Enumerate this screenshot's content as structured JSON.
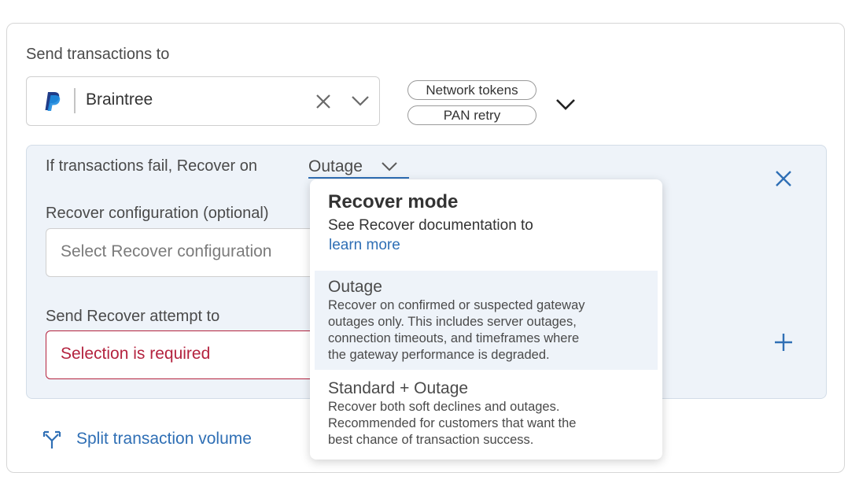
{
  "send_transactions": {
    "label": "Send transactions to",
    "gateway_value": "Braintree",
    "gateway_icon": "paypal-logo",
    "chips": [
      "Network tokens",
      "PAN retry"
    ]
  },
  "recover": {
    "fail_label": "If transactions fail, Recover on",
    "mode_value": "Outage",
    "config_label": "Recover configuration (optional)",
    "config_placeholder": "Select Recover configuration",
    "attempt_label": "Send Recover attempt to",
    "attempt_error": "Selection is required"
  },
  "split_link": "Split transaction volume",
  "dropdown": {
    "title": "Recover mode",
    "subtitle": "See Recover documentation to",
    "link": "learn more",
    "options": [
      {
        "title": "Outage",
        "desc": [
          "Recover on confirmed or suspected gateway",
          "outages only. This includes server outages,",
          "connection timeouts, and timeframes where",
          "the gateway performance is degraded."
        ],
        "selected": true
      },
      {
        "title": "Standard + Outage",
        "desc": [
          "Recover both soft declines and outages.",
          "Recommended for customers that want the",
          "best chance of transaction success."
        ],
        "selected": false
      }
    ]
  },
  "colors": {
    "accent": "#2f6fb5",
    "error": "#b4233f",
    "panel_bg": "#eef3f9"
  }
}
